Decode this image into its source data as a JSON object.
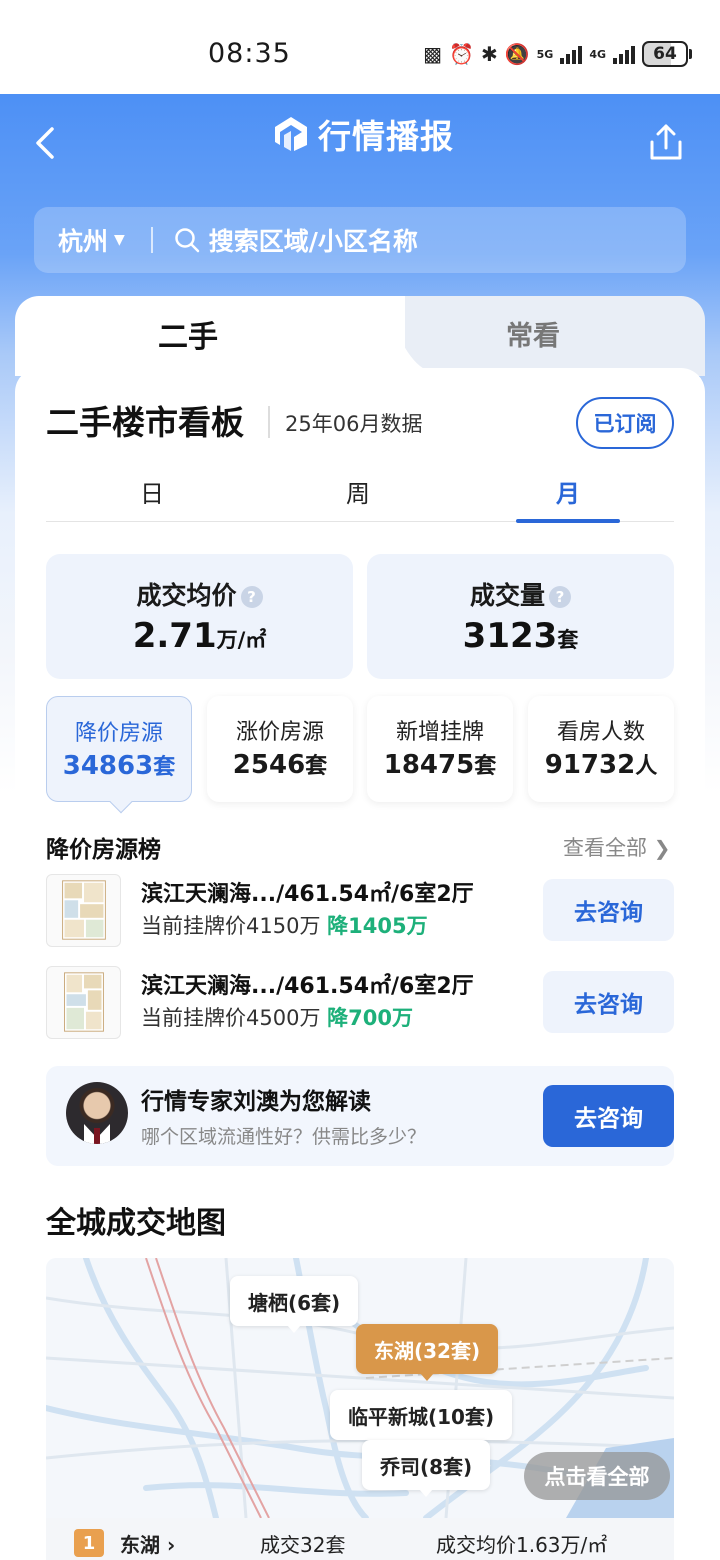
{
  "status_bar": {
    "time": "08:35",
    "icons": [
      "nfc-icon",
      "alarm-icon",
      "bluetooth-icon",
      "mute-icon",
      "5g-signal-icon",
      "4g-signal-icon"
    ],
    "network_1": "5G",
    "network_2": "4G",
    "battery": "64"
  },
  "header": {
    "title": "行情播报",
    "city": "杭州",
    "search_placeholder": "搜索区域/小区名称"
  },
  "tabs": [
    "二手",
    "常看"
  ],
  "board": {
    "title": "二手楼市看板",
    "date": "25年06月数据",
    "subscribe_label": "已订阅",
    "periods": [
      "日",
      "周",
      "月"
    ],
    "active_period": "月"
  },
  "stats_main": [
    {
      "label": "成交均价",
      "value": "2.71",
      "unit": "万/㎡"
    },
    {
      "label": "成交量",
      "value": "3123",
      "unit": "套"
    }
  ],
  "stats_sub": [
    {
      "label": "降价房源",
      "value": "34863",
      "unit": "套"
    },
    {
      "label": "涨价房源",
      "value": "2546",
      "unit": "套"
    },
    {
      "label": "新增挂牌",
      "value": "18475",
      "unit": "套"
    },
    {
      "label": "看房人数",
      "value": "91732",
      "unit": "人"
    }
  ],
  "price_drop_list": {
    "title": "降价房源榜",
    "see_all": "查看全部",
    "items": [
      {
        "name": "滨江天澜海.../461.54㎡/6室2厅",
        "price_prefix": "当前挂牌价4150万",
        "drop": "降1405万",
        "button": "去咨询"
      },
      {
        "name": "滨江天澜海.../461.54㎡/6室2厅",
        "price_prefix": "当前挂牌价4500万",
        "drop": "降700万",
        "button": "去咨询"
      }
    ]
  },
  "expert": {
    "title": "行情专家刘澳为您解读",
    "subtitle": "哪个区域流通性好？供需比多少？",
    "button": "去咨询"
  },
  "map": {
    "title": "全城成交地图",
    "pins": [
      "塘栖(6套)",
      "东湖(32套)",
      "临平新城(10套)",
      "乔司(8套)"
    ],
    "view_all": "点击看全部"
  },
  "ranking": [
    {
      "rank": "1",
      "area": "东湖",
      "deals": "成交32套",
      "avg_price": "成交均价1.63万/㎡"
    }
  ],
  "colors": {
    "brand_blue": "#2a67d8",
    "header_blue": "#4d90f5",
    "drop_green": "#1db07a",
    "hot_pin": "#d9974a"
  }
}
